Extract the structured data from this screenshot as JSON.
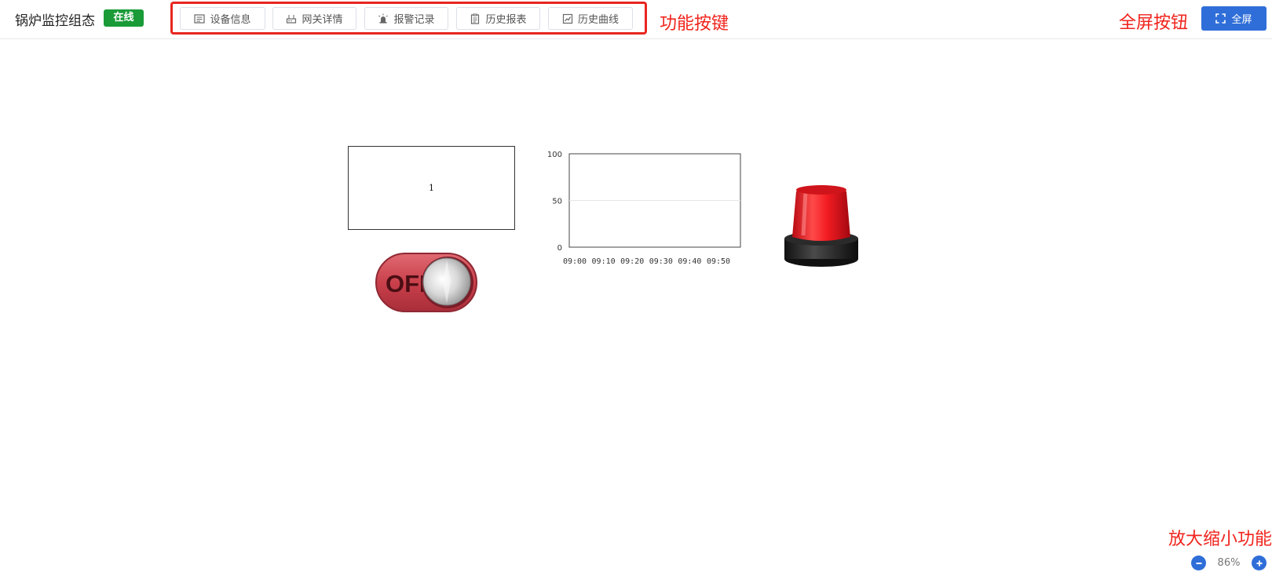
{
  "header": {
    "title": "锅炉监控组态",
    "status_badge": "在线",
    "toolbar": [
      {
        "label": "设备信息",
        "icon": "device-info-icon"
      },
      {
        "label": "网关详情",
        "icon": "gateway-icon"
      },
      {
        "label": "报警记录",
        "icon": "alarm-icon"
      },
      {
        "label": "历史报表",
        "icon": "report-icon"
      },
      {
        "label": "历史曲线",
        "icon": "curve-icon"
      }
    ],
    "fullscreen_label": "全屏"
  },
  "annotations": {
    "toolbar": "功能按键",
    "fullscreen": "全屏按钮",
    "zoom": "放大缩小功能"
  },
  "canvas": {
    "text_value": "1",
    "toggle_label": "OFF",
    "toggle_state": "off"
  },
  "chart_data": {
    "type": "line",
    "x": [
      "09:00",
      "09:10",
      "09:20",
      "09:30",
      "09:40",
      "09:50"
    ],
    "series": [],
    "ylim": [
      0,
      100
    ],
    "yticks": [
      0,
      50,
      100
    ],
    "grid": true
  },
  "zoom": {
    "level": "86%"
  },
  "colors": {
    "accent": "#2f6ed8",
    "online": "#1a9b38",
    "annotation": "#f0231c",
    "alarm_red": "#e8141c"
  }
}
